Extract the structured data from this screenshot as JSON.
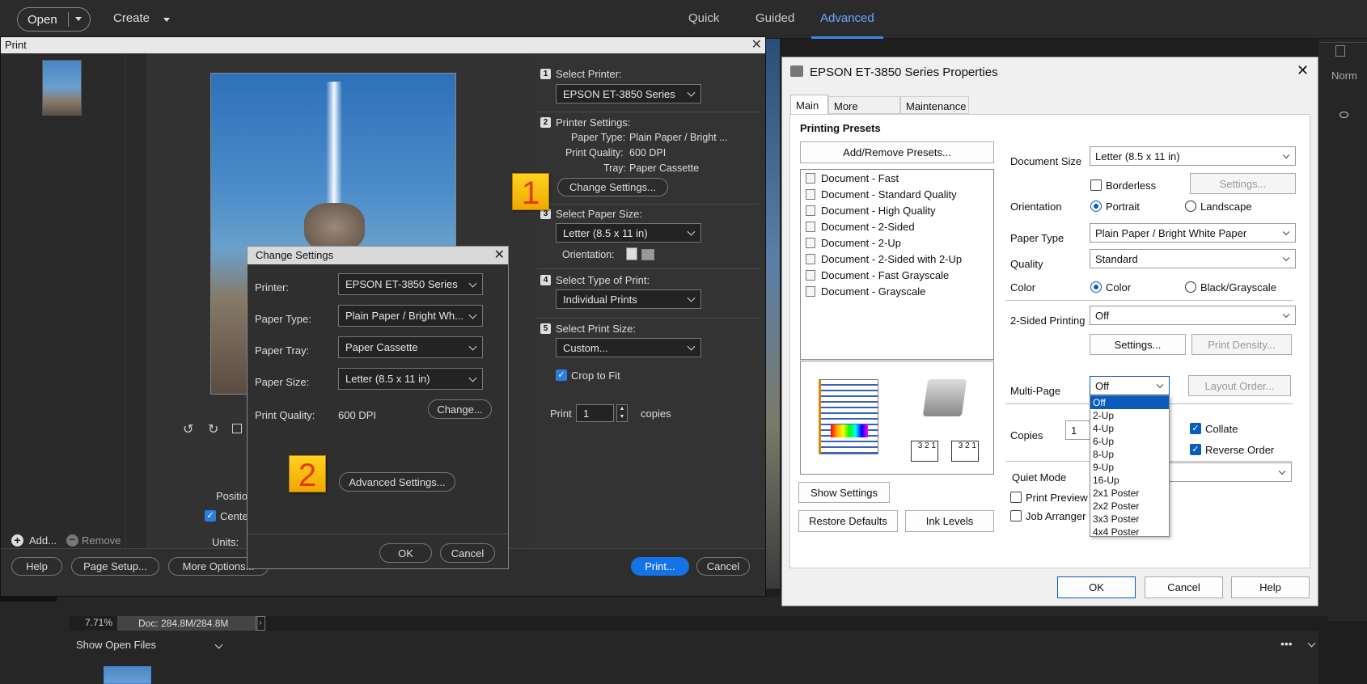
{
  "top": {
    "open": "Open",
    "create": "Create",
    "modes": [
      "Quick",
      "Guided",
      "Advanced"
    ]
  },
  "print": {
    "title": "Print",
    "step1_label": "Select Printer:",
    "printer": "EPSON ET-3850 Series",
    "step2_label": "Printer Settings:",
    "paper_type_label": "Paper Type:",
    "paper_type": "Plain Paper / Bright ...",
    "print_quality_label": "Print Quality:",
    "print_quality": "600 DPI",
    "tray_label": "Tray:",
    "tray": "Paper Cassette",
    "change_settings": "Change Settings...",
    "step3_label": "Select Paper Size:",
    "paper_size": "Letter (8.5 x 11 in)",
    "orientation_label": "Orientation:",
    "step4_label": "Select Type of Print:",
    "print_type": "Individual Prints",
    "step5_label": "Select Print Size:",
    "print_size": "Custom...",
    "crop_label": "Crop to Fit",
    "print_label": "Print",
    "copies": "1",
    "copies_label": "copies",
    "position_label": "Positio",
    "center_label": "Cente",
    "units_label": "Units:",
    "add": "Add...",
    "remove": "Remove",
    "help": "Help",
    "page_setup": "Page Setup...",
    "more_options": "More Options...",
    "print_btn": "Print...",
    "cancel": "Cancel"
  },
  "change": {
    "title": "Change Settings",
    "printer_label": "Printer:",
    "printer": "EPSON ET-3850 Series",
    "paper_type_label": "Paper Type:",
    "paper_type": "Plain Paper / Bright Wh...",
    "paper_tray_label": "Paper Tray:",
    "paper_tray": "Paper Cassette",
    "paper_size_label": "Paper Size:",
    "paper_size": "Letter (8.5 x 11 in)",
    "quality_label": "Print Quality:",
    "quality": "600 DPI",
    "change": "Change...",
    "advanced": "Advanced Settings...",
    "ok": "OK",
    "cancel": "Cancel"
  },
  "badges": [
    "1",
    "2",
    "3",
    "4"
  ],
  "status": {
    "zoom": "7.71%",
    "doc": "Doc: 284.8M/284.8M",
    "show_open": "Show Open Files",
    "right_label": "Norm"
  },
  "epson": {
    "title": "EPSON ET-3850 Series Properties",
    "tabs": [
      "Main",
      "More Options",
      "Maintenance"
    ],
    "presets_title": "Printing Presets",
    "add_remove": "Add/Remove Presets...",
    "presets": [
      "Document - Fast",
      "Document - Standard Quality",
      "Document - High Quality",
      "Document - 2-Sided",
      "Document - 2-Up",
      "Document - 2-Sided with 2-Up",
      "Document - Fast Grayscale",
      "Document - Grayscale"
    ],
    "doc_size_label": "Document Size",
    "doc_size": "Letter (8.5 x 11 in)",
    "borderless": "Borderless",
    "settings": "Settings...",
    "orientation_label": "Orientation",
    "portrait": "Portrait",
    "landscape": "Landscape",
    "paper_type_label": "Paper Type",
    "paper_type": "Plain Paper / Bright White Paper",
    "quality_label": "Quality",
    "quality": "Standard",
    "color_label": "Color",
    "color": "Color",
    "bw": "Black/Grayscale",
    "two_sided_label": "2-Sided Printing",
    "two_sided": "Off",
    "settings2": "Settings...",
    "print_density": "Print Density...",
    "multipage_label": "Multi-Page",
    "multipage": "Off",
    "layout_order": "Layout Order...",
    "multipage_options": [
      "Off",
      "2-Up",
      "4-Up",
      "6-Up",
      "8-Up",
      "9-Up",
      "16-Up",
      "2x1 Poster",
      "2x2 Poster",
      "3x3 Poster",
      "4x4 Poster"
    ],
    "copies_label": "Copies",
    "copies": "1",
    "collate": "Collate",
    "reverse": "Reverse Order",
    "quiet_label": "Quiet Mode",
    "print_preview": "Print Preview",
    "job_arranger": "Job Arranger Li",
    "show_settings": "Show Settings",
    "restore": "Restore Defaults",
    "ink": "Ink Levels",
    "ok": "OK",
    "cancel": "Cancel",
    "help": "Help"
  }
}
